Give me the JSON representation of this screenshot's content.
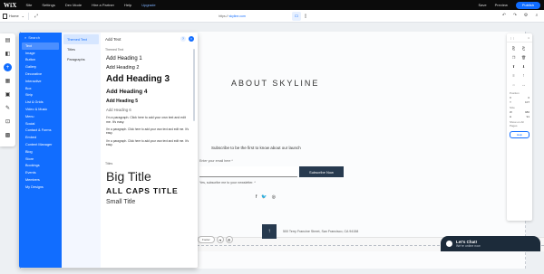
{
  "menubar": {
    "logo": "WiX",
    "items": [
      "Site",
      "Settings",
      "Dev Mode",
      "Hire a Partner",
      "Help"
    ],
    "upgrade": "Upgrade",
    "right": [
      "Save",
      "Preview"
    ],
    "publish": "Publish"
  },
  "toolbar": {
    "page": "Home",
    "url_prefix": "https://",
    "url_domain": "skyline.com"
  },
  "add_panel": {
    "search": "Search",
    "categories": [
      "Text",
      "Image",
      "Button",
      "Gallery",
      "Decorative",
      "Interactive",
      "Box",
      "Strip",
      "List & Grids",
      "Video & Music",
      "Menu",
      "Social",
      "Contact & Forms",
      "Embed",
      "Content Manager",
      "Blog",
      "Store",
      "Bookings",
      "Events",
      "Members",
      "My Designs"
    ],
    "subcategories": [
      "Themed Text",
      "Titles",
      "Paragraphs"
    ],
    "content_title": "Add Text",
    "themed_label": "Themed Text",
    "headings": [
      "Add Heading 1",
      "Add Heading 2",
      "Add Heading 3",
      "Add Heading 4",
      "Add Heading 5",
      "Add Heading 6"
    ],
    "paragraphs": [
      "I'm a paragraph. Click here to add your own text and edit me. It's easy.",
      "I'm a paragraph. Click here to add your own text and edit me. It's easy.",
      "I'm a paragraph. Click here to add your own text and edit me. It's easy."
    ],
    "titles_label": "Titles",
    "titles": [
      "Big Title",
      "ALL CAPS TITLE",
      "Small Title"
    ]
  },
  "site": {
    "title": "ABOUT SKYLINE",
    "subscribe_text": "Subscribe to be the first to know about our launch",
    "email_label": "Enter your email here *",
    "subscribe_button": "Subscribe Now",
    "consent": "Yes, subscribe me to your newsletter. *",
    "address": "500 Terry Francine Street, San Francisco, CA 94158",
    "strip_label": "Footer"
  },
  "chat": {
    "title": "Let's Chat!",
    "subtitle": "We're online now"
  },
  "inspector": {
    "position_label": "Position",
    "x_label": "X",
    "x_value": "0",
    "y_label": "Y",
    "y_value": "107",
    "size_label": "Size",
    "w_label": "W",
    "w_value": "980",
    "h_label": "H",
    "h_value": "91",
    "rotation_label": "Show on All Pages",
    "button": "Help"
  },
  "colors": {
    "accent": "#116dff",
    "dark_button": "#273a4f",
    "chat_bg": "#1c2b3a"
  }
}
